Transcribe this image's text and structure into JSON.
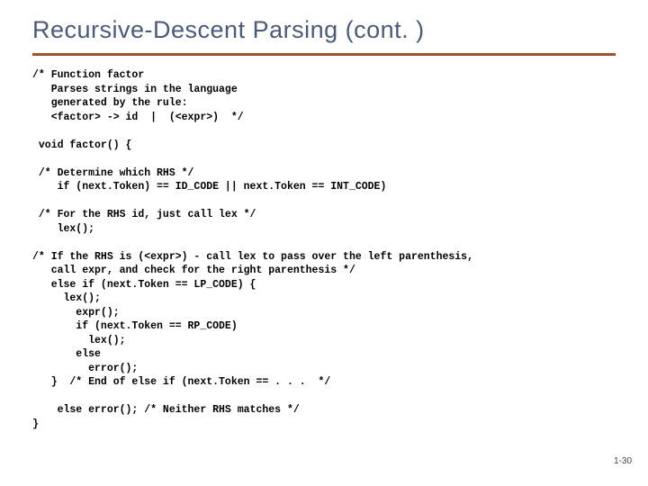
{
  "title": "Recursive-Descent Parsing (cont. )",
  "code": "/* Function factor\n   Parses strings in the language\n   generated by the rule:\n   <factor> -> id  |  (<expr>)  */\n\n void factor() {\n\n /* Determine which RHS */\n    if (next.Token) == ID_CODE || next.Token == INT_CODE)\n\n /* For the RHS id, just call lex */\n    lex();\n\n/* If the RHS is (<expr>) - call lex to pass over the left parenthesis,\n   call expr, and check for the right parenthesis */\n   else if (next.Token == LP_CODE) {\n     lex();\n       expr();\n       if (next.Token == RP_CODE)\n         lex();\n       else\n         error();\n   }  /* End of else if (next.Token == . . .  */\n\n    else error(); /* Neither RHS matches */\n}",
  "footer": "1-30"
}
